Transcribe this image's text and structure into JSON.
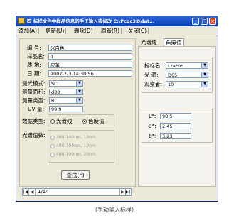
{
  "window": {
    "title": "四 标样文件中样品信息的手工输入或修改  C:\\Pcqc32\\dat...",
    "min_glyph": "_",
    "max_glyph": "□",
    "close_glyph": "×"
  },
  "menu": [
    {
      "label": "添加(A)"
    },
    {
      "label": "更新(U)"
    },
    {
      "label": "删除(D)"
    },
    {
      "label": "刷新(R)"
    },
    {
      "label": "关闭(C)"
    }
  ],
  "form": {
    "number_label": "编  号:",
    "number_value": "米白色",
    "sample_name_label": "样品名:",
    "sample_name_value": "1",
    "material_label": "质  地:",
    "material_value": "皮革",
    "date_label": "日  期:",
    "date_value": "2007-7-3 14:30:56",
    "light_mode_label": "测光模式:",
    "light_mode_value": "SCI",
    "area_label": "测量面积:",
    "area_value": "d30",
    "type_label": "测量类型:",
    "type_value": "R",
    "uv_label": "UV 量:",
    "uv_value": "99.9",
    "datatype_label": "数据类型:",
    "datatype_options": [
      "光谱线",
      "色度值"
    ],
    "datatype_selected": "色度值",
    "spectral_label": "光谱值数:",
    "spectral_options": [
      "360-740nm, 10nm",
      "400-700nm, 10nm",
      "400-700nm, 20nm"
    ],
    "find_button": "查找(F)"
  },
  "tabs": [
    "光谱线",
    "色度值"
  ],
  "active_tab": "色度值",
  "color_panel": {
    "index_label": "指标名:",
    "index_value": "L*a*b*",
    "illuminant_label": "光  源:",
    "illuminant_value": "D65",
    "observer_label": "观察者:",
    "observer_value": "10",
    "L_label": "L*:",
    "L_value": "98.5",
    "a_label": "a*:",
    "a_value": "2.45",
    "b_label": "b*:",
    "b_value": "3.23"
  },
  "navigator": {
    "first": "|◀",
    "prev": "◀",
    "position": "1/14",
    "next": "▶",
    "last": "▶|"
  },
  "caption": "（手动输入标样）"
}
